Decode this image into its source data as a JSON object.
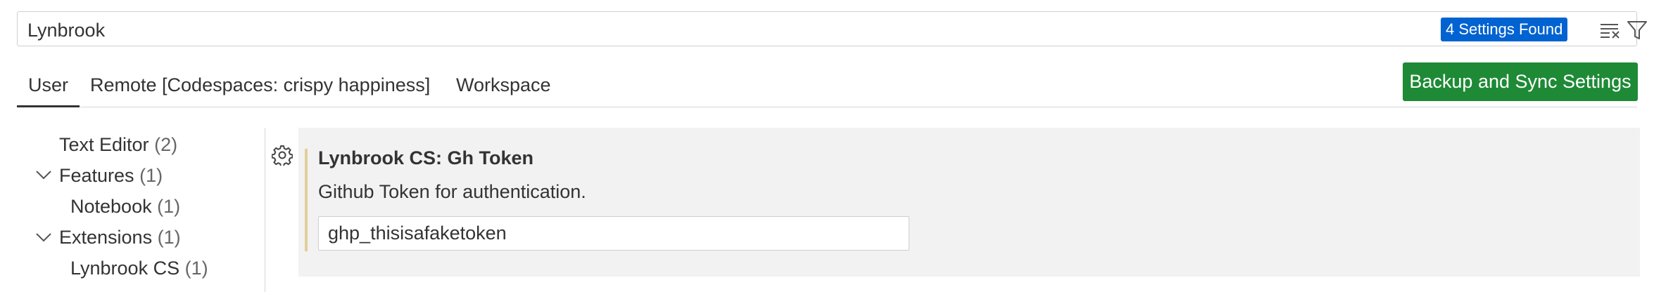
{
  "search": {
    "value": "Lynbrook",
    "results_badge": "4 Settings Found",
    "clear_icon": "clear-filter-icon",
    "filter_icon": "filter-icon"
  },
  "tabs": [
    {
      "label": "User",
      "active": true
    },
    {
      "label": "Remote [Codespaces: crispy happiness]",
      "active": false
    },
    {
      "label": "Workspace",
      "active": false
    }
  ],
  "sync_button": {
    "label": "Backup and Sync Settings",
    "color": "#1e8a36"
  },
  "toc": [
    {
      "label": "Text Editor",
      "count": "(2)",
      "expandable": false
    },
    {
      "label": "Features",
      "count": "(1)",
      "expandable": true,
      "expanded": true
    },
    {
      "label": "Notebook",
      "count": "(1)",
      "expandable": false
    },
    {
      "label": "Extensions",
      "count": "(1)",
      "expandable": true,
      "expanded": true
    },
    {
      "label": "Lynbrook CS",
      "count": "(1)",
      "expandable": false
    }
  ],
  "setting": {
    "title": "Lynbrook CS: Gh Token",
    "description": "Github Token for authentication.",
    "value": "ghp_thisisafaketoken",
    "gear_icon": "gear-icon",
    "modified_indicator_color": "#e0cf99"
  },
  "colors": {
    "badge": "#0063d1",
    "panel_background": "#f2f2f2"
  }
}
